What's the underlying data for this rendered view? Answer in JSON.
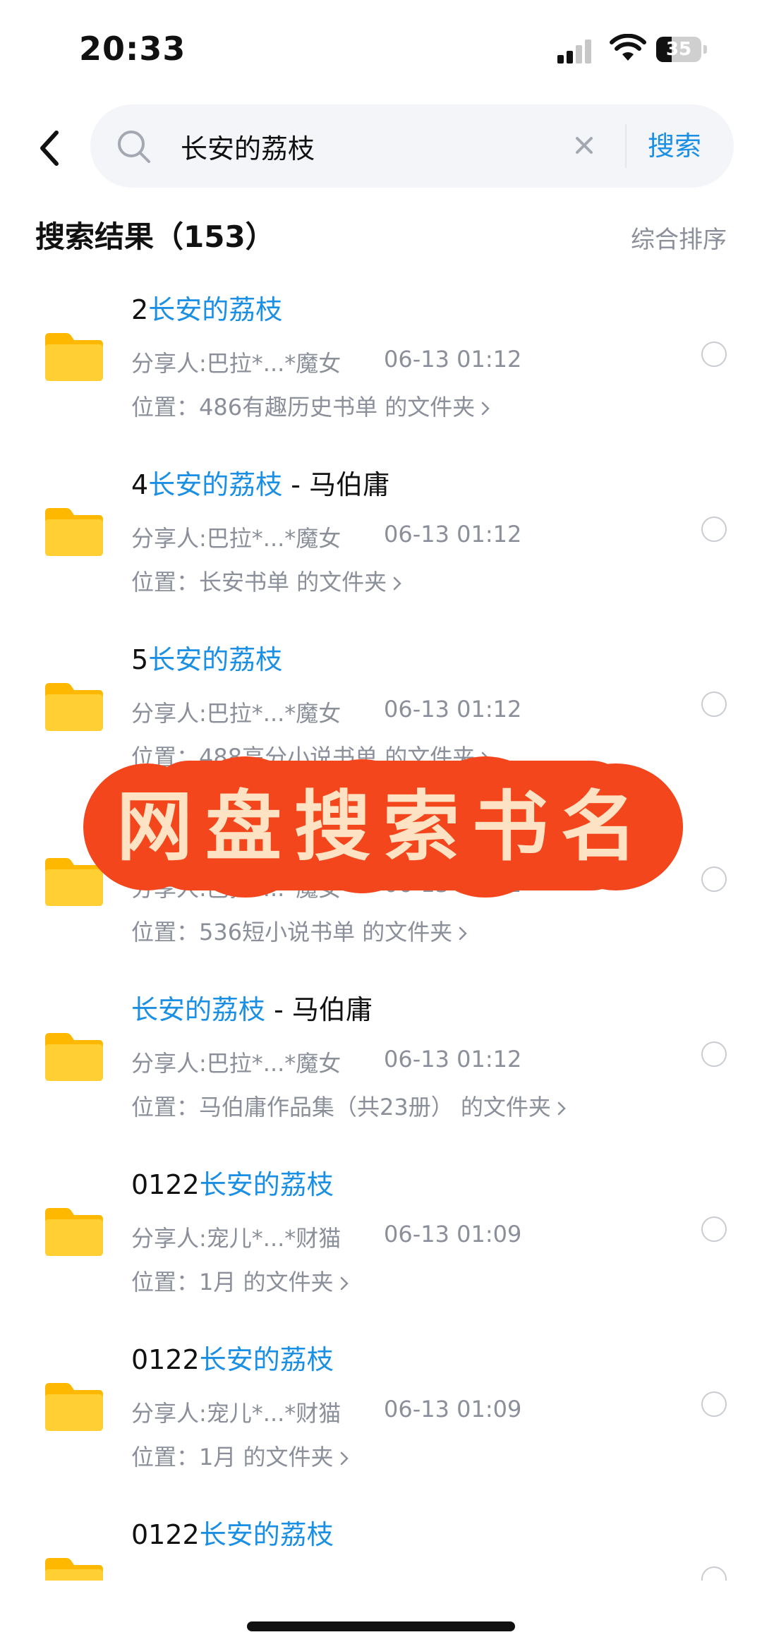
{
  "status_bar": {
    "time": "20:33",
    "battery": "35"
  },
  "search": {
    "query": "长安的荔枝",
    "placeholder": "",
    "button_label": "搜索"
  },
  "results_header": {
    "title": "搜索结果（153）",
    "sort_label": "综合排序"
  },
  "results": [
    {
      "title_prefix": "2",
      "title_highlight": "长安的荔枝",
      "title_suffix": "",
      "sharer": "分享人:巴拉*...*魔女",
      "time": "06-13 01:12",
      "location": "位置：486有趣历史书单 的文件夹"
    },
    {
      "title_prefix": "4",
      "title_highlight": "长安的荔枝",
      "title_suffix": " - 马伯庸",
      "sharer": "分享人:巴拉*...*魔女",
      "time": "06-13 01:12",
      "location": "位置：长安书单 的文件夹"
    },
    {
      "title_prefix": "5",
      "title_highlight": "长安的荔枝",
      "title_suffix": "",
      "sharer": "分享人:巴拉*...*魔女",
      "time": "06-13 01:12",
      "location": "位置：488高分小说书单 的文件夹"
    },
    {
      "title_prefix": "",
      "title_highlight": "",
      "title_suffix": "",
      "sharer": "分享人:巴拉*...*魔女",
      "time": "06-13 01:12",
      "location": "位置：536短小说书单 的文件夹"
    },
    {
      "title_prefix": "",
      "title_highlight": "长安的荔枝",
      "title_suffix": " - 马伯庸",
      "sharer": "分享人:巴拉*...*魔女",
      "time": "06-13 01:12",
      "location": "位置：马伯庸作品集（共23册） 的文件夹"
    },
    {
      "title_prefix": "0122",
      "title_highlight": "长安的荔枝",
      "title_suffix": "",
      "sharer": "分享人:宠儿*...*财猫",
      "time": "06-13 01:09",
      "location": "位置：1月 的文件夹"
    },
    {
      "title_prefix": "0122",
      "title_highlight": "长安的荔枝",
      "title_suffix": "",
      "sharer": "分享人:宠儿*...*财猫",
      "time": "06-13 01:09",
      "location": "位置：1月 的文件夹"
    },
    {
      "title_prefix": "0122",
      "title_highlight": "长安的荔枝",
      "title_suffix": "",
      "sharer": "",
      "time": "",
      "location": ""
    }
  ],
  "overlay": {
    "text": "网盘搜索书名"
  },
  "colors": {
    "accent": "#1a8fe3",
    "banner_bg": "#f4461c",
    "banner_text": "#fde3c3",
    "folder": "#ffc61a"
  }
}
